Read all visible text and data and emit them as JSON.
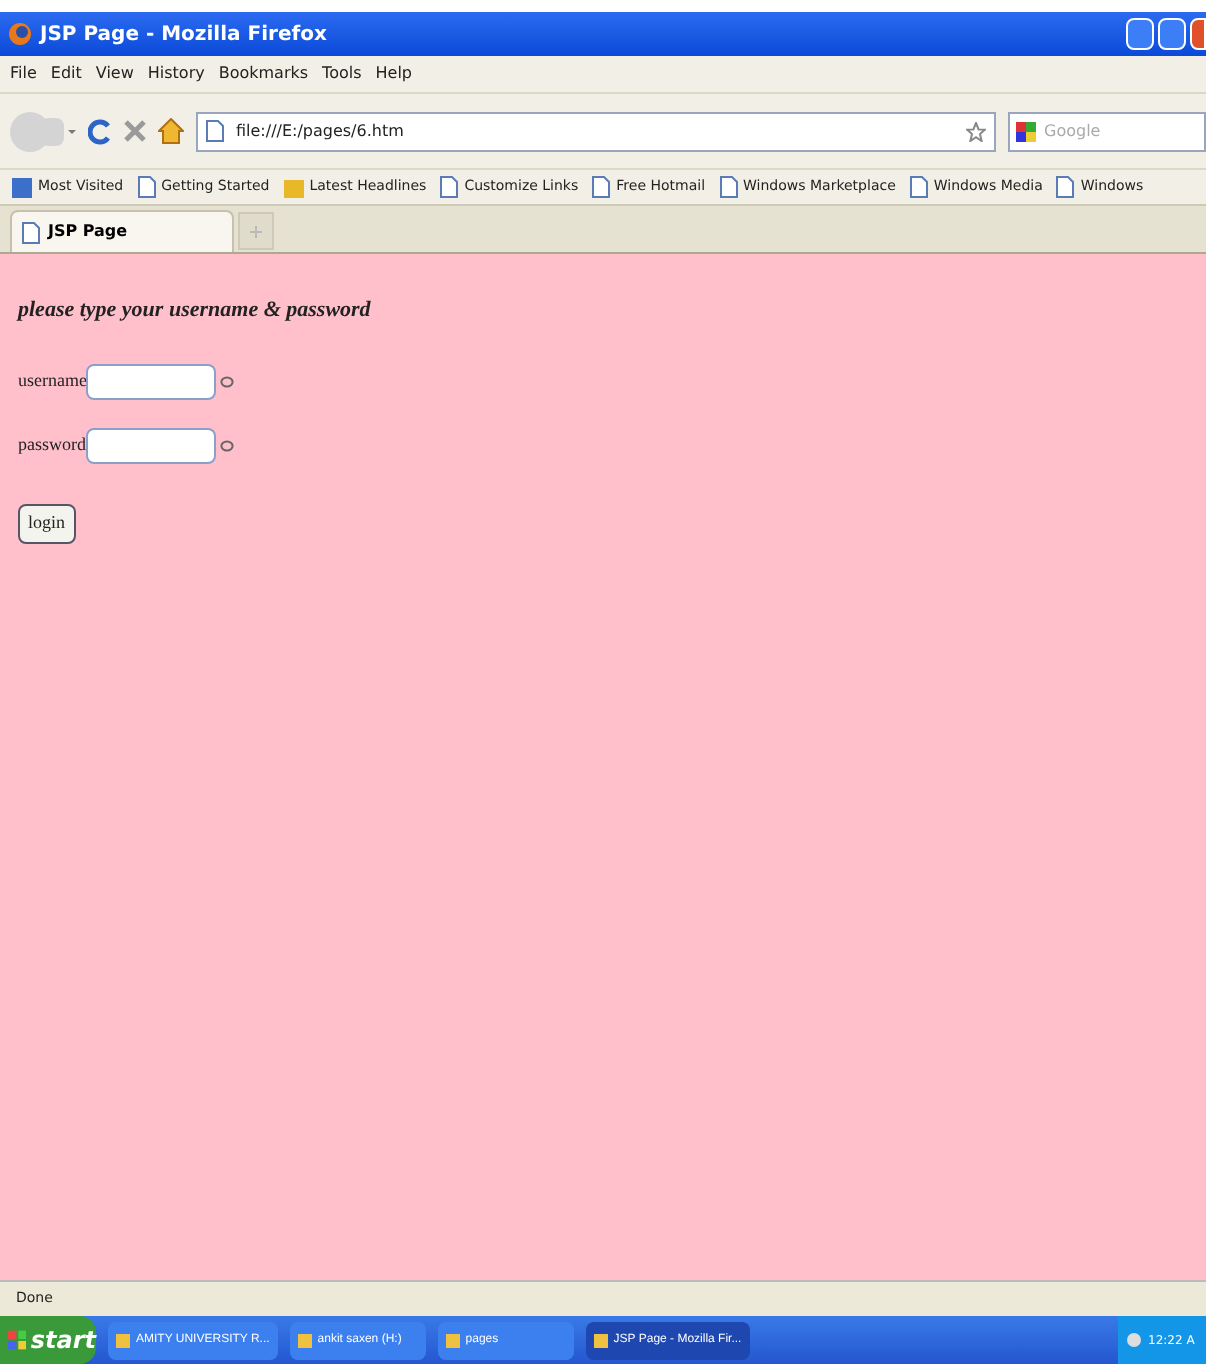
{
  "window": {
    "title": "JSP Page - Mozilla Firefox"
  },
  "menu": [
    "File",
    "Edit",
    "View",
    "History",
    "Bookmarks",
    "Tools",
    "Help"
  ],
  "address": {
    "value": "file:///E:/pages/6.htm"
  },
  "search": {
    "placeholder": "Google"
  },
  "bookmarks": [
    {
      "label": "Most Visited",
      "kind": "folder"
    },
    {
      "label": "Getting Started",
      "kind": "page"
    },
    {
      "label": "Latest Headlines",
      "kind": "feed"
    },
    {
      "label": "Customize Links",
      "kind": "page"
    },
    {
      "label": "Free Hotmail",
      "kind": "page"
    },
    {
      "label": "Windows Marketplace",
      "kind": "page"
    },
    {
      "label": "Windows Media",
      "kind": "page"
    },
    {
      "label": "Windows",
      "kind": "page"
    }
  ],
  "tabs": [
    {
      "label": "JSP Page",
      "selected": true
    }
  ],
  "page": {
    "heading": "please type your username & password",
    "fields": [
      {
        "label": "username"
      },
      {
        "label": "password"
      }
    ],
    "button": "login"
  },
  "status_bar": "Done",
  "taskbar": {
    "start": "start",
    "items": [
      {
        "label": "AMITY UNIVERSITY R...",
        "selected": false
      },
      {
        "label": "ankit saxen (H:)",
        "selected": false
      },
      {
        "label": "pages",
        "selected": false
      },
      {
        "label": "JSP Page - Mozilla Fir...",
        "selected": true
      }
    ],
    "clock": "12:22 A"
  }
}
